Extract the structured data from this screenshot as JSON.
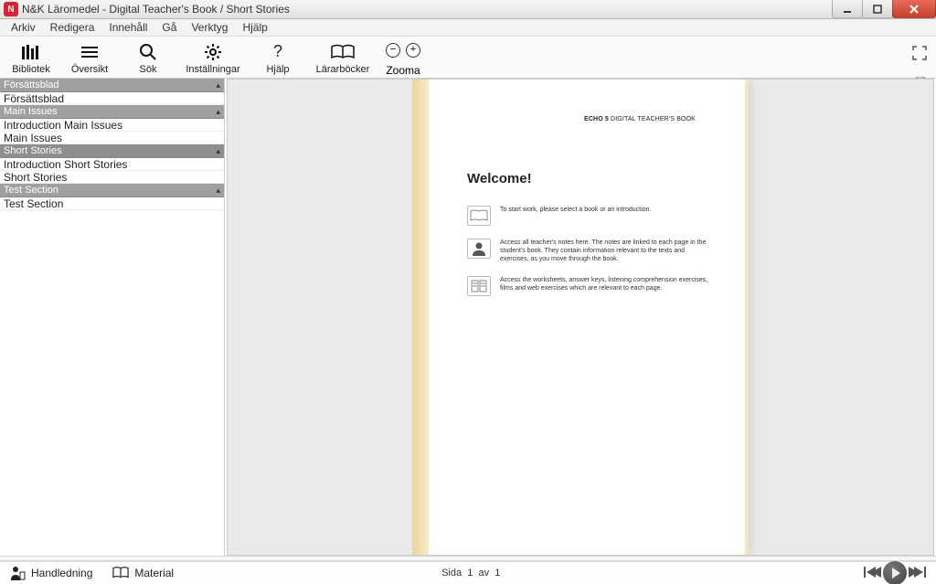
{
  "window": {
    "title": "N&K Läromedel - Digital Teacher's Book / Short Stories",
    "app_icon_letter": "N"
  },
  "menus": {
    "arkiv": "Arkiv",
    "redigera": "Redigera",
    "innehall": "Innehåll",
    "ga": "Gå",
    "verktyg": "Verktyg",
    "hjalp": "Hjälp"
  },
  "toolbar": {
    "bibliotek": "Bibliotek",
    "oversikt": "Översikt",
    "sok": "Sök",
    "installningar": "Inställningar",
    "hjalp": "Hjälp",
    "lararbocker": "Lärarböcker",
    "zooma": "Zooma"
  },
  "sidebar": {
    "sections": [
      {
        "title": "Försättsblad",
        "items": [
          "Försättsblad"
        ]
      },
      {
        "title": "Main Issues",
        "items": [
          "Introduction Main Issues",
          "Main Issues"
        ]
      },
      {
        "title": "Short Stories",
        "items": [
          "Introduction Short Stories",
          "Short Stories"
        ]
      },
      {
        "title": "Test Section",
        "items": [
          "Test Section"
        ]
      }
    ]
  },
  "page": {
    "header_bold": "ECHO 5",
    "header_rest": " DIGITAL TEACHER'S BOOK",
    "welcome": "Welcome!",
    "rows": [
      "To start work, please select a book or an introduction.",
      "Access all teacher's notes here. The notes are linked to each page in the student's book. They contain information relevant to the texts and exercises, as you move through the book.",
      "Access the worksheets, answer keys, listening comprehension exercises, films and web exercises which are relevant to each page."
    ]
  },
  "statusbar": {
    "handledning": "Handledning",
    "material": "Material",
    "sida": "Sida",
    "cur": "1",
    "av": "av",
    "tot": "1"
  }
}
